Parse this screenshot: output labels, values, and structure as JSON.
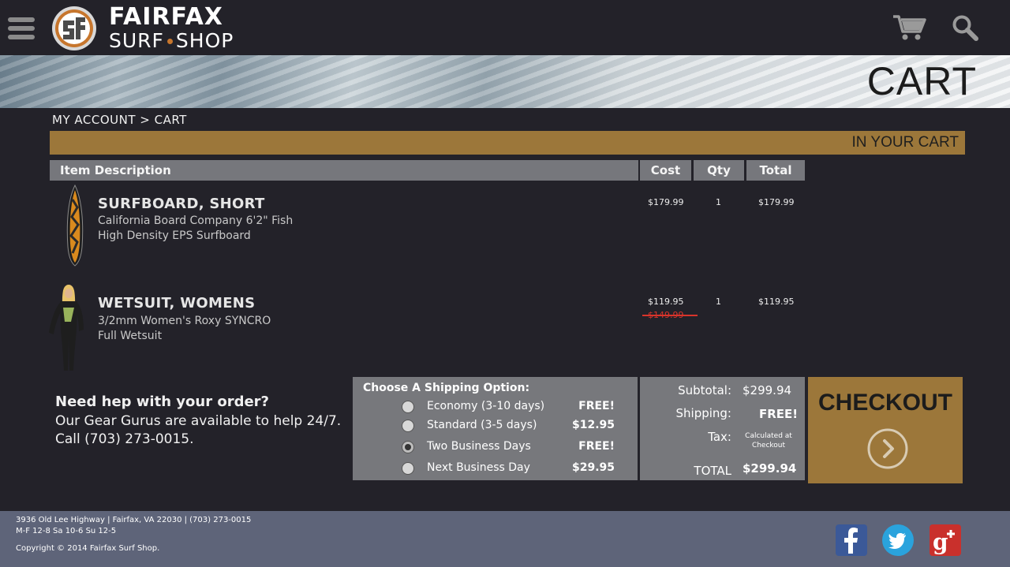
{
  "header": {
    "logo_top": "FAIRFAX",
    "logo_bottom_left": "SURF",
    "logo_bottom_right": "SHOP"
  },
  "banner": {
    "title": "CART"
  },
  "breadcrumb": {
    "text": "MY ACCOUNT > CART"
  },
  "cart_bar": {
    "label": "IN YOUR CART"
  },
  "table": {
    "headers": {
      "description": "Item Description",
      "cost": "Cost",
      "qty": "Qty",
      "total": "Total"
    },
    "items": [
      {
        "name": "SURFBOARD, SHORT",
        "desc_line1": "California Board Company 6'2\" Fish",
        "desc_line2": "High Density EPS Surfboard",
        "cost": "$179.99",
        "qty": "1",
        "total": "$179.99"
      },
      {
        "name": "WETSUIT, WOMENS",
        "desc_line1": "3/2mm Women's Roxy SYNCRO",
        "desc_line2": "Full Wetsuit",
        "cost": "$119.95",
        "old_cost": "$149.99",
        "qty": "1",
        "total": "$119.95"
      }
    ]
  },
  "help": {
    "title": "Need hep with your order?",
    "line1": "Our Gear Gurus are available to help 24/7.",
    "line2": "Call (703) 273-0015."
  },
  "shipping": {
    "title": "Choose A Shipping Option:",
    "selected_index": 2,
    "options": [
      {
        "label": "Economy (3-10 days)",
        "price": "FREE!"
      },
      {
        "label": "Standard (3-5 days)",
        "price": "$12.95"
      },
      {
        "label": "Two Business Days",
        "price": "FREE!"
      },
      {
        "label": "Next Business Day",
        "price": "$29.95"
      }
    ]
  },
  "totals": {
    "subtotal_label": "Subtotal:",
    "subtotal": "$299.94",
    "shipping_label": "Shipping:",
    "shipping": "FREE!",
    "tax_label": "Tax:",
    "tax_note_line1": "Calculated at",
    "tax_note_line2": "Checkout",
    "total_label": "TOTAL",
    "total": "$299.94"
  },
  "checkout": {
    "label": "CHECKOUT"
  },
  "footer": {
    "address": "3936 Old Lee Highway  |  Fairfax, VA 22030  |  (703) 273-0015",
    "hours": "M-F 12-8   Sa 10-6  Su 12-5",
    "copyright": "Copyright © 2014 Fairfax Surf Shop."
  },
  "colors": {
    "background": "#232229",
    "accent_gold": "#9c773a",
    "panel_gray": "#77787c",
    "footer": "#5e6479",
    "logo_orange": "#c7762d",
    "facebook": "#3b5998",
    "twitter": "#2aa3dd",
    "google_plus": "#c9302c"
  },
  "icons": [
    "menu-icon",
    "logo-mark-icon",
    "cart-icon",
    "search-icon",
    "chevron-right-icon",
    "facebook-icon",
    "twitter-icon",
    "google-plus-icon"
  ]
}
